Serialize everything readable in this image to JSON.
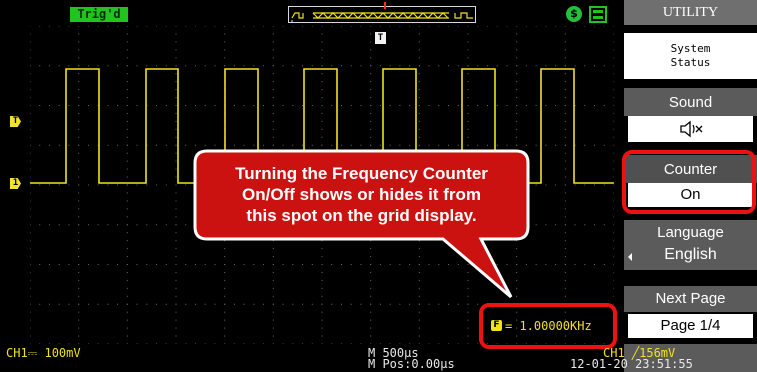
{
  "status_bar": {
    "trigger_state": "Trig'd",
    "usb_icon": "usb-icon",
    "printer_icon": "printer-icon"
  },
  "markers": {
    "trigger_position": "T",
    "trigger_level": "T",
    "channel1": "1"
  },
  "readouts": {
    "ch1_scale": "CH1⎓ 100mV",
    "time_base": "M 500μs",
    "time_position": "M Pos:0.00μs",
    "trigger_info": "CH1 ╱156mV",
    "date_time": "12-01-20 23:51:55"
  },
  "freq_counter": {
    "icon": "F",
    "value": "= 1.00000KHz"
  },
  "callout": {
    "lines": [
      "Turning the Frequency Counter",
      "On/Off shows or hides it from",
      "this spot on the grid display."
    ]
  },
  "menu": {
    "title": "UTILITY",
    "system_status_line1": "System",
    "system_status_line2": "Status",
    "sound_label": "Sound",
    "sound_value_icon": "speaker-muted-icon",
    "counter_label": "Counter",
    "counter_value": "On",
    "language_label": "Language",
    "language_value": "English",
    "next_page_label": "Next Page",
    "next_page_value": "Page 1/4"
  },
  "colors": {
    "trace": "#f1e11f",
    "highlight": "#ee1111",
    "callout_fill": "#cc1111",
    "trig_badge": "#1fc41f"
  }
}
